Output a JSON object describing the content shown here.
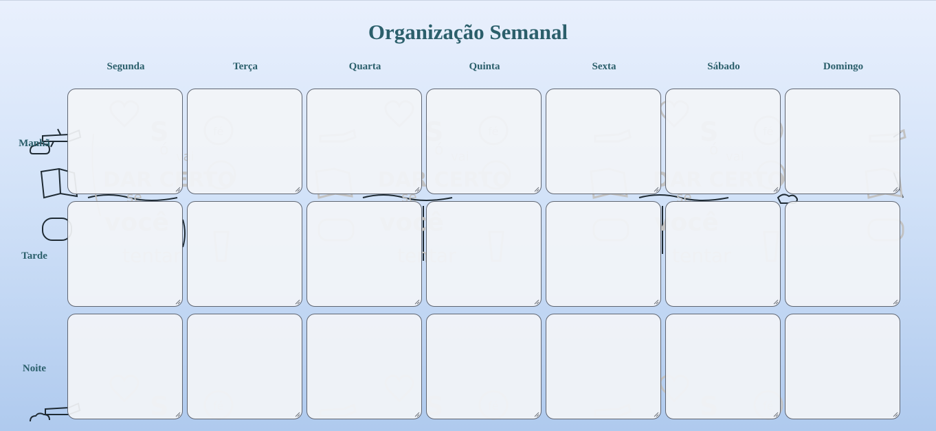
{
  "title": "Organização Semanal",
  "days": [
    "Segunda",
    "Terça",
    "Quarta",
    "Quinta",
    "Sexta",
    "Sábado",
    "Domingo"
  ],
  "periods": [
    "Manhã",
    "Tarde",
    "Noite"
  ],
  "watermark": {
    "line1": "Só",
    "line2": "vai",
    "line3": "DAR CERTO",
    "line4": "se",
    "line5": "você",
    "line6": "tentar",
    "bubble_fe": "fé",
    "bubble_gratidao": "gratidão"
  },
  "colors": {
    "heading": "#2b5f6b",
    "cell_border": "#5e6470",
    "cell_fill": "#f2f4f8",
    "background_top": "#e9f0fd",
    "background_bottom": "#afcaee",
    "watermark": "#c2c2c2"
  }
}
